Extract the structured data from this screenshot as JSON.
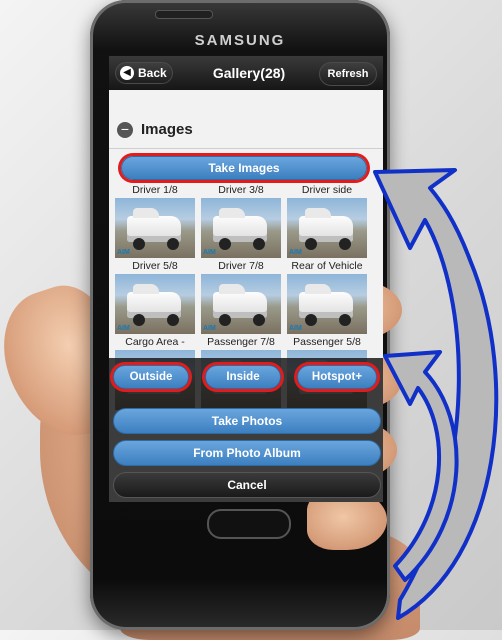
{
  "device": {
    "brand": "SAMSUNG"
  },
  "header": {
    "back_label": "Back",
    "title": "Gallery(28)",
    "refresh_label": "Refresh"
  },
  "section": {
    "title": "Images"
  },
  "take_images_label": "Take Images",
  "thumbnails": [
    {
      "label": "Driver 1/8"
    },
    {
      "label": "Driver 3/8"
    },
    {
      "label": "Driver side"
    },
    {
      "label": "Driver 5/8"
    },
    {
      "label": "Driver 7/8"
    },
    {
      "label": "Rear of Vehicle"
    },
    {
      "label": "Cargo Area -"
    },
    {
      "label": "Passenger 7/8"
    },
    {
      "label": "Passenger 5/8"
    }
  ],
  "watermark": "AIM",
  "action_sheet": {
    "segments": [
      "Outside",
      "Inside",
      "Hotspot+"
    ],
    "take_photos_label": "Take Photos",
    "photo_album_label": "From Photo Album",
    "cancel_label": "Cancel"
  },
  "colors": {
    "button_blue": "#3c7fc0",
    "highlight_red": "#e31b1b",
    "arrow_blue": "#1030c8",
    "arrow_fill": "#b9b9b9"
  }
}
